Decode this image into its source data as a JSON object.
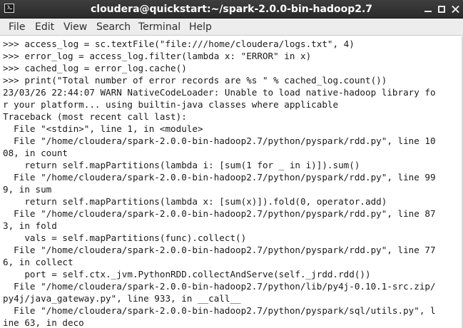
{
  "window": {
    "title": "cloudera@quickstart:~/spark-2.0.0-bin-hadoop2.7"
  },
  "menubar": {
    "items": [
      "File",
      "Edit",
      "View",
      "Search",
      "Terminal",
      "Help"
    ]
  },
  "terminal": {
    "lines": [
      ">>> access_log = sc.textFile(\"file:///home/cloudera/logs.txt\", 4)",
      ">>> error_log = access_log.filter(lambda x: \"ERROR\" in x)",
      ">>> cached_log = error_log.cache()",
      ">>> print(\"Total number of error records are %s \" % cached_log.count())",
      "23/03/26 22:44:07 WARN NativeCodeLoader: Unable to load native-hadoop library fo",
      "r your platform... using builtin-java classes where applicable",
      "Traceback (most recent call last):",
      "  File \"<stdin>\", line 1, in <module>",
      "  File \"/home/cloudera/spark-2.0.0-bin-hadoop2.7/python/pyspark/rdd.py\", line 10",
      "08, in count",
      "    return self.mapPartitions(lambda i: [sum(1 for _ in i)]).sum()",
      "  File \"/home/cloudera/spark-2.0.0-bin-hadoop2.7/python/pyspark/rdd.py\", line 99",
      "9, in sum",
      "    return self.mapPartitions(lambda x: [sum(x)]).fold(0, operator.add)",
      "  File \"/home/cloudera/spark-2.0.0-bin-hadoop2.7/python/pyspark/rdd.py\", line 87",
      "3, in fold",
      "    vals = self.mapPartitions(func).collect()",
      "  File \"/home/cloudera/spark-2.0.0-bin-hadoop2.7/python/pyspark/rdd.py\", line 77",
      "6, in collect",
      "    port = self.ctx._jvm.PythonRDD.collectAndServe(self._jrdd.rdd())",
      "  File \"/home/cloudera/spark-2.0.0-bin-hadoop2.7/python/lib/py4j-0.10.1-src.zip/",
      "py4j/java_gateway.py\", line 933, in __call__",
      "  File \"/home/cloudera/spark-2.0.0-bin-hadoop2.7/python/pyspark/sql/utils.py\", l",
      "ine 63, in deco"
    ]
  }
}
